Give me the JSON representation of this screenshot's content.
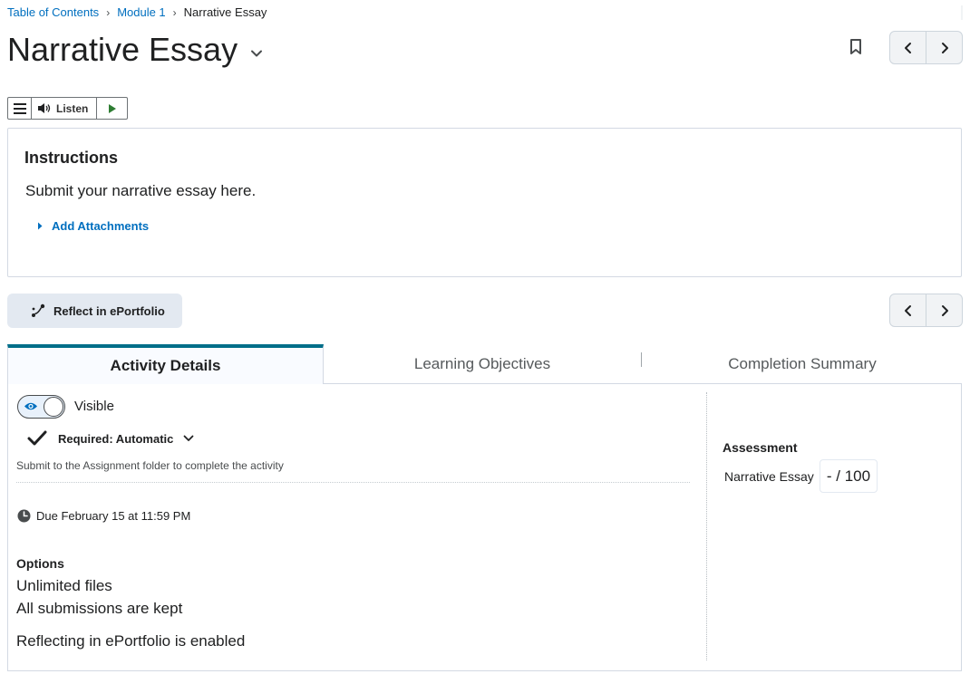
{
  "breadcrumb": {
    "items": [
      "Table of Contents",
      "Module 1"
    ],
    "current": "Narrative Essay",
    "separator": "›"
  },
  "page": {
    "title": "Narrative Essay"
  },
  "toolbar": {
    "listen_label": "Listen"
  },
  "instructions": {
    "heading": "Instructions",
    "body": "Submit your narrative essay here.",
    "add_attachments": "Add Attachments"
  },
  "reflect": {
    "label": "Reflect in ePortfolio"
  },
  "tabs": [
    {
      "label": "Activity Details",
      "active": true
    },
    {
      "label": "Learning Objectives",
      "active": false
    },
    {
      "label": "Completion Summary",
      "active": false
    }
  ],
  "details": {
    "visibility_label": "Visible",
    "required_label": "Required: Automatic",
    "completion_note": "Submit to the Assignment folder to complete the activity",
    "due": "Due February 15 at 11:59 PM",
    "options_heading": "Options",
    "options": [
      "Unlimited files",
      "All submissions are kept"
    ],
    "eportfolio_note": "Reflecting in ePortfolio is enabled"
  },
  "assessment": {
    "heading": "Assessment",
    "item_name": "Narrative Essay",
    "score": "- / 100"
  },
  "colors": {
    "link": "#006fbf",
    "tab_accent": "#006e89",
    "play_green": "#2e7d32",
    "reflect_bg": "#e3e9f1"
  },
  "icons": [
    "chevron-down-icon",
    "bookmark-icon",
    "chevron-left-icon",
    "chevron-right-icon",
    "menu-icon",
    "speaker-icon",
    "play-icon",
    "caret-right-icon",
    "eportfolio-icon",
    "eye-icon",
    "checkmark-icon",
    "clock-icon"
  ]
}
